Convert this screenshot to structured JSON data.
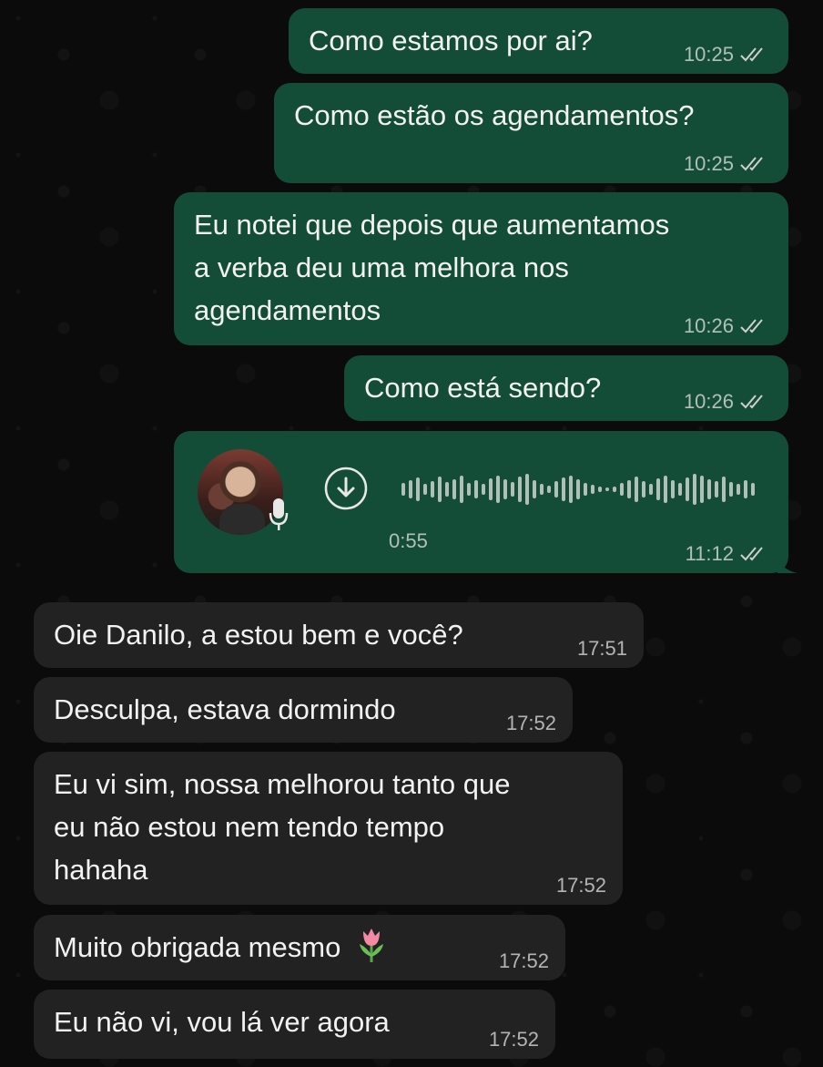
{
  "messages": {
    "m1": {
      "text": "Como estamos por ai?",
      "time": "10:25"
    },
    "m2": {
      "text": "Como estão os agendamentos?",
      "time": "10:25"
    },
    "m3": {
      "lines": [
        "Eu notei que depois que aumentamos",
        "a verba deu uma melhora nos",
        "agendamentos"
      ],
      "time": "10:26"
    },
    "m4": {
      "text": "Como está sendo?",
      "time": "10:26"
    },
    "audio": {
      "duration": "0:55",
      "time": "11:12",
      "icons": [
        "download-icon",
        "mic-icon"
      ]
    },
    "r1": {
      "text": "Oie Danilo, a estou bem e você?",
      "time": "17:51"
    },
    "r2": {
      "text": "Desculpa, estava dormindo",
      "time": "17:52"
    },
    "r3": {
      "lines": [
        "Eu vi sim, nossa melhorou tanto que",
        "eu não estou nem tendo tempo",
        "hahaha"
      ],
      "time": "17:52"
    },
    "r4": {
      "text": "Muito obrigada mesmo",
      "emoji": "tulip-emoji",
      "time": "17:52"
    },
    "r5": {
      "text": "Eu não vi, vou lá ver agora",
      "time": "17:52"
    }
  },
  "colors": {
    "outgoing_bubble": "#144d37",
    "incoming_bubble": "#222222",
    "background": "#0b0b0b"
  }
}
